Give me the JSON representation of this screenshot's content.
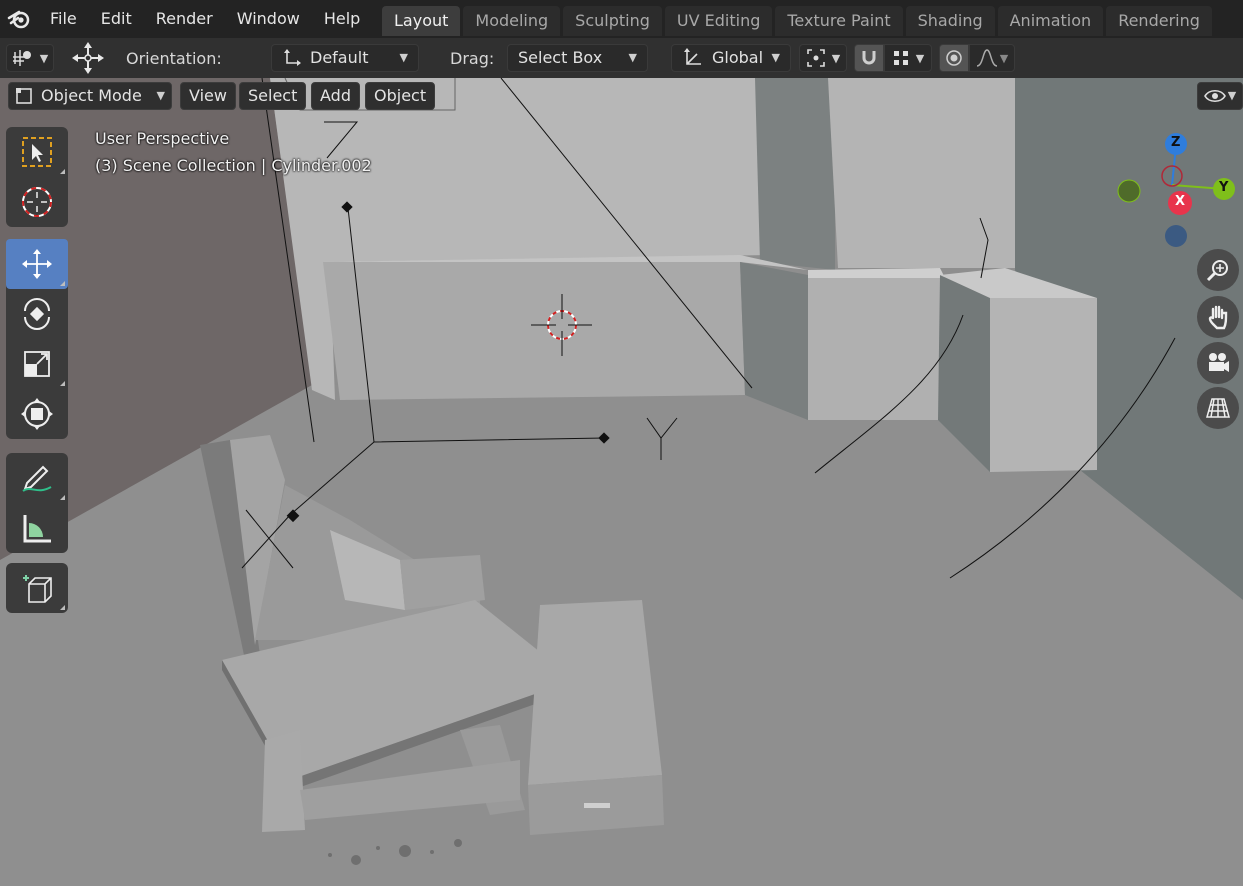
{
  "menu": {
    "file": "File",
    "edit": "Edit",
    "render": "Render",
    "window": "Window",
    "help": "Help"
  },
  "workspaces": [
    {
      "label": "Layout",
      "active": true
    },
    {
      "label": "Modeling"
    },
    {
      "label": "Sculpting"
    },
    {
      "label": "UV Editing"
    },
    {
      "label": "Texture Paint"
    },
    {
      "label": "Shading"
    },
    {
      "label": "Animation"
    },
    {
      "label": "Rendering"
    }
  ],
  "tool_header": {
    "orientation_label": "Orientation:",
    "orientation_value": "Default",
    "drag_label": "Drag:",
    "drag_value": "Select Box",
    "transform_orientation": "Global"
  },
  "viewport_header": {
    "mode": "Object Mode",
    "view": "View",
    "select": "Select",
    "add": "Add",
    "object": "Object"
  },
  "overlay": {
    "perspective": "User Perspective",
    "collection": "(3) Scene Collection | Cylinder.002"
  },
  "gizmo": {
    "z": "Z",
    "y": "Y",
    "x": "X"
  },
  "icons": {
    "tools": [
      "select-box-icon",
      "cursor-icon",
      "move-icon",
      "rotate-icon",
      "scale-icon",
      "transform-icon",
      "annotate-icon",
      "measure-icon",
      "add-cube-icon"
    ],
    "nav": [
      "zoom-icon",
      "hand-icon",
      "camera-icon",
      "grid-icon"
    ]
  },
  "colors": {
    "accent": "#5680c2",
    "axis_x": "#e8344c",
    "axis_y": "#7fbf1a",
    "axis_z": "#2f7ddc"
  }
}
